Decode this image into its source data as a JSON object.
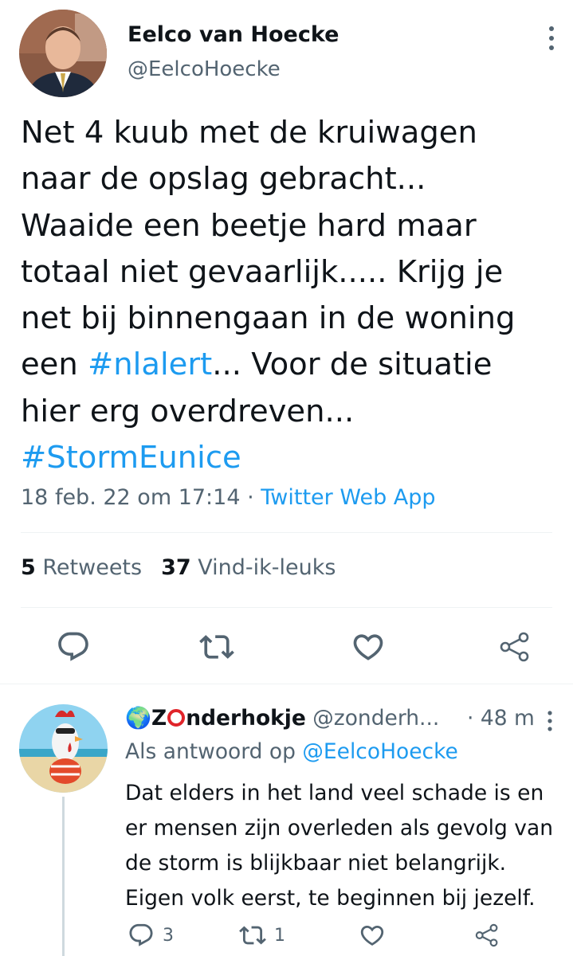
{
  "tweet": {
    "author": {
      "name": "Eelco van Hoecke",
      "handle": "@EelcoHoecke"
    },
    "text_lines": [
      "Net 4 kuub met de kruiwagen",
      "naar de opslag gebracht...",
      "Waaide een beetje hard maar",
      "totaal niet gevaarlijk..... Krijg je",
      "net bij binnengaan in de woning"
    ],
    "line6_pre": "een ",
    "line6_link": "#nlalert",
    "line6_post": "... Voor de situatie",
    "line7": "hier erg overdreven...",
    "hashtag": "#StormEunice",
    "timestamp": "18 feb. 22 om 17:14",
    "separator": " · ",
    "source_app": "Twitter Web App",
    "stats": {
      "retweets_count": "5",
      "retweets_label": " Retweets",
      "likes_count": "37",
      "likes_label": " Vind-ik-leuks"
    }
  },
  "reply": {
    "emoji": "🌍",
    "name_z": "Z",
    "name_rest": "nderhokje",
    "handle": " @zonderh...",
    "time": "· 48 m",
    "replying_prefix": "Als antwoord op ",
    "replying_handle": "@EelcoHoecke",
    "text_lines": [
      "Dat elders in het land veel schade is en",
      "er mensen zijn overleden als gevolg van",
      "de storm is blijkbaar niet belangrijk.",
      "Eigen volk eerst, te beginnen bij jezelf."
    ],
    "reply_count": "3",
    "retweet_count": "1"
  },
  "icons": {
    "reply": "reply-icon",
    "retweet": "retweet-icon",
    "like": "heart-icon",
    "share": "share-icon",
    "more": "more-vertical-icon"
  },
  "colors": {
    "link": "#1d9bf0",
    "secondary_text": "#536471",
    "primary_text": "#0f1419"
  }
}
